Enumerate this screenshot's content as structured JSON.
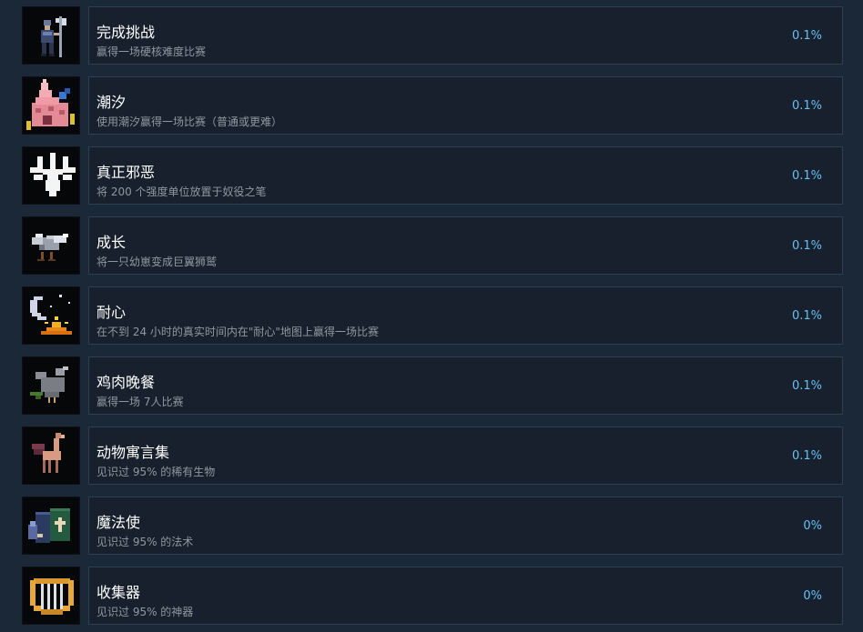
{
  "achievements": [
    {
      "icon": "knight-halberd-icon",
      "title": "完成挑战",
      "desc": "赢得一场硬核难度比赛",
      "pct": "0.1%"
    },
    {
      "icon": "pink-shell-creature-icon",
      "title": "潮汐",
      "desc": "使用潮汐赢得一场比赛（普通或更难）",
      "pct": "0.1%"
    },
    {
      "icon": "white-splash-icon",
      "title": "真正邪恶",
      "desc": "将 200 个强度单位放置于奴役之笔",
      "pct": "0.1%"
    },
    {
      "icon": "griffin-chick-icon",
      "title": "成长",
      "desc": "将一只幼崽变成巨翼狮鹫",
      "pct": "0.1%"
    },
    {
      "icon": "moon-sunrise-icon",
      "title": "耐心",
      "desc": "在不到 24 小时的真实时间内在\"耐心\"地图上赢得一场比赛",
      "pct": "0.1%"
    },
    {
      "icon": "grey-bird-icon",
      "title": "鸡肉晚餐",
      "desc": "赢得一场 7人比赛",
      "pct": "0.1%"
    },
    {
      "icon": "winged-deer-icon",
      "title": "动物寓言集",
      "desc": "见识过 95% 的稀有生物",
      "pct": "0.1%"
    },
    {
      "icon": "spell-books-icon",
      "title": "魔法使",
      "desc": "见识过 95% 的法术",
      "pct": "0%"
    },
    {
      "icon": "golden-lyre-icon",
      "title": "收集器",
      "desc": "见识过 95% 的神器",
      "pct": "0%"
    }
  ]
}
